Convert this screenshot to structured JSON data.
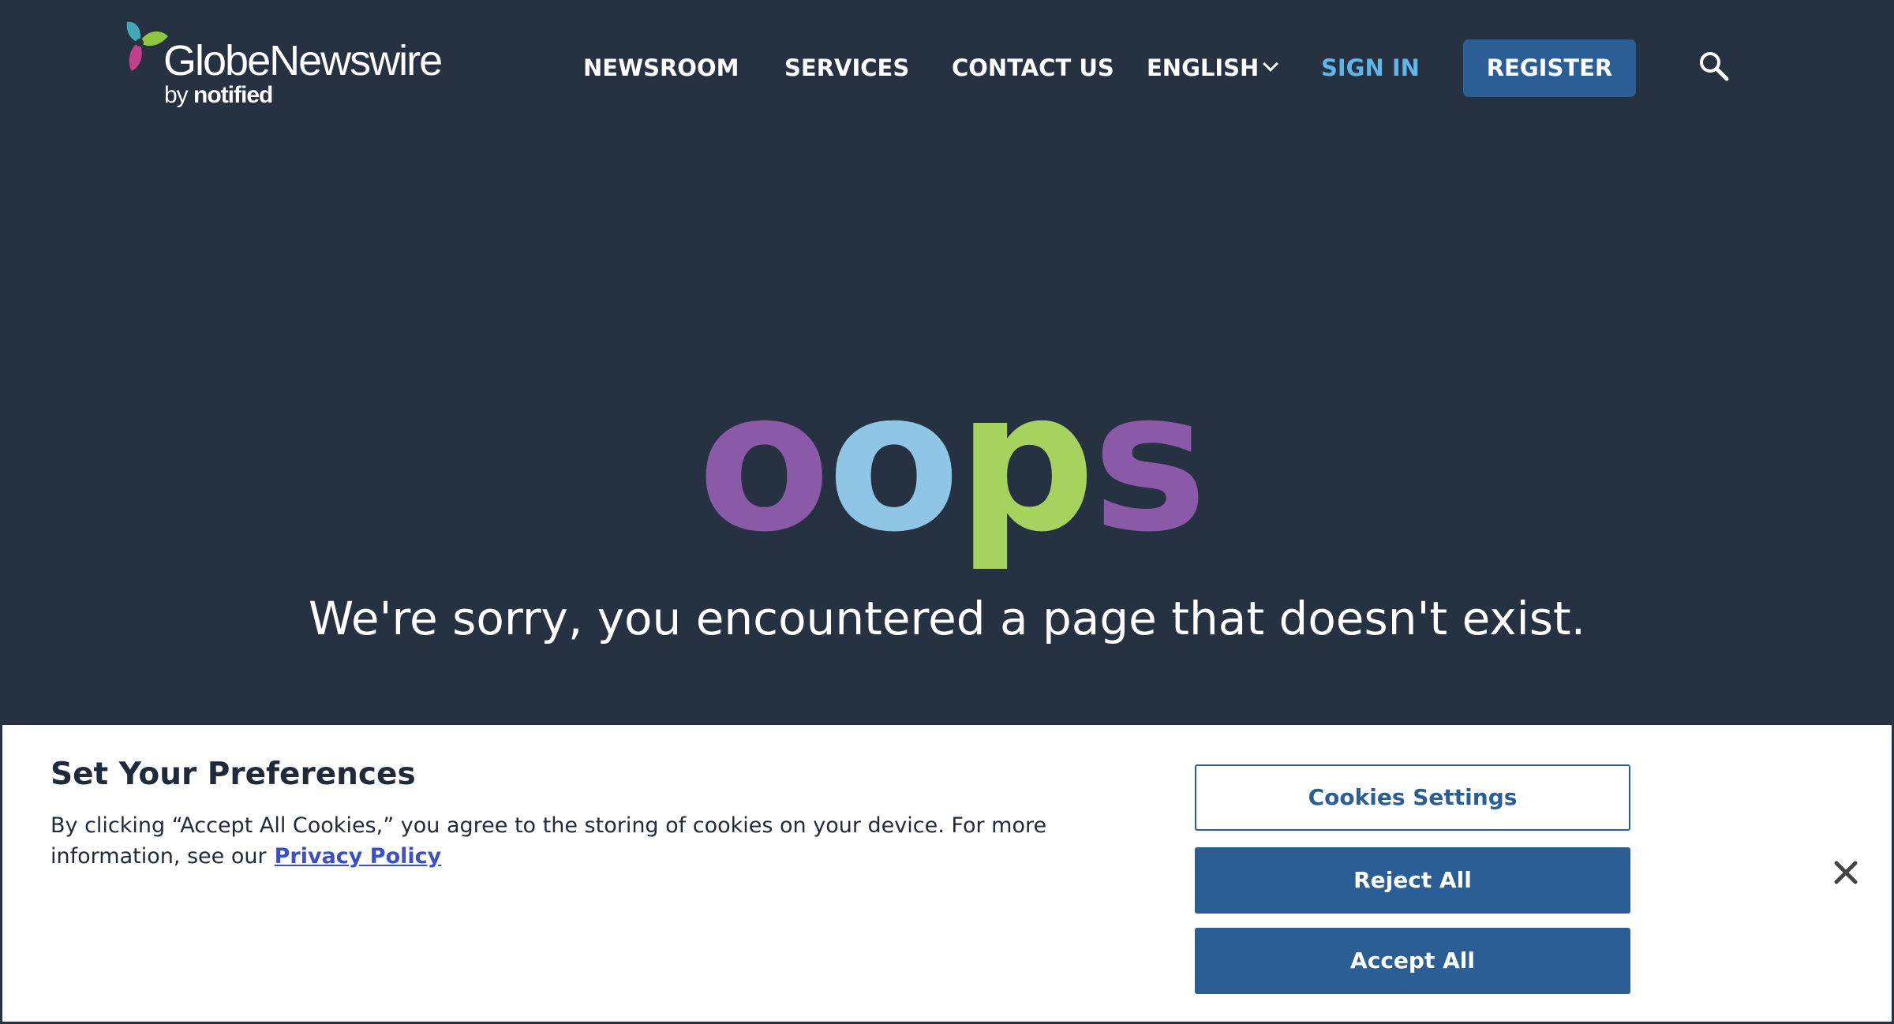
{
  "header": {
    "logo": {
      "name": "GlobeNewswire",
      "tagline_prefix": "by",
      "tagline_brand": "notified"
    },
    "nav": {
      "newsroom": "NEWSROOM",
      "services": "SERVICES",
      "contact": "CONTACT US",
      "language": "ENGLISH",
      "sign_in": "SIGN IN",
      "register": "REGISTER"
    },
    "icons": {
      "search": "search-icon",
      "language_dropdown": "chevron-down-icon"
    }
  },
  "hero": {
    "headline": "oops",
    "message": "We're sorry, you encountered a page that doesn't exist."
  },
  "cookie_banner": {
    "title": "Set Your Preferences",
    "text": "By clicking “Accept All Cookies,” you agree to the storing of cookies on your device. For more information, see our",
    "privacy_link": "Privacy Policy",
    "settings_button": "Cookies Settings",
    "reject_button": "Reject All",
    "accept_button": "Accept All",
    "close_icon": "close-icon"
  },
  "colors": {
    "background": "#263142",
    "primary_button": "#2b5e95",
    "sign_in": "#5fb7e8",
    "oops_purple": "#8a5aa8",
    "oops_blue": "#8fc6e6",
    "oops_green": "#a6d35e",
    "link": "#3b4fc9"
  }
}
